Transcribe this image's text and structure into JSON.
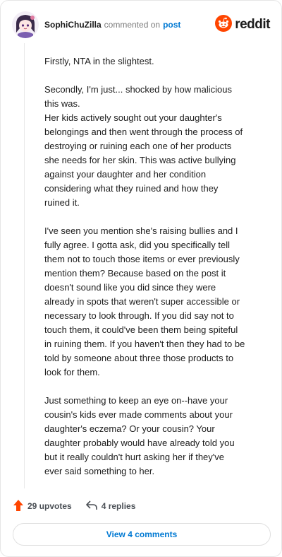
{
  "header": {
    "username": "SophiChuZilla",
    "commented_text": "commented on",
    "post_link": "post",
    "brand": "reddit"
  },
  "comment": {
    "paragraphs": [
      [
        "Firstly, NTA in the slightest."
      ],
      [
        "Secondly, I'm just... shocked by how malicious",
        "this was.",
        "Her kids actively sought out your daughter's",
        "belongings and then went through the process of",
        "destroying or ruining each one of her products",
        "she needs for her skin. This was active bullying",
        "against your daughter and her condition",
        "considering what they ruined and how they",
        "ruined it."
      ],
      [
        "I've seen you mention she's raising bullies and I",
        "fully agree. I gotta ask, did you specifically tell",
        "them not to touch those items or ever previously",
        "mention them? Because based on the post it",
        "doesn't sound like you did since they were",
        "already in spots that weren't super accessible or",
        "necessary to look through. If you did say not to",
        "touch them, it could've been them being spiteful",
        "in ruining them. If you haven't then they had to be",
        "told by someone about three those products to",
        "look for them."
      ],
      [
        "Just something to keep an eye on--have your",
        "cousin's kids ever made comments about your",
        "daughter's eczema? Or your cousin? Your",
        "daughter probably would have already told you",
        "but it really couldn't hurt asking her if they've",
        "ever said something to her."
      ]
    ]
  },
  "actions": {
    "upvotes": "29 upvotes",
    "replies": "4 replies"
  },
  "view_button": "View 4 comments",
  "colors": {
    "upvote": "#ff4500",
    "link": "#0079d3",
    "reddit_orange": "#ff4500"
  }
}
